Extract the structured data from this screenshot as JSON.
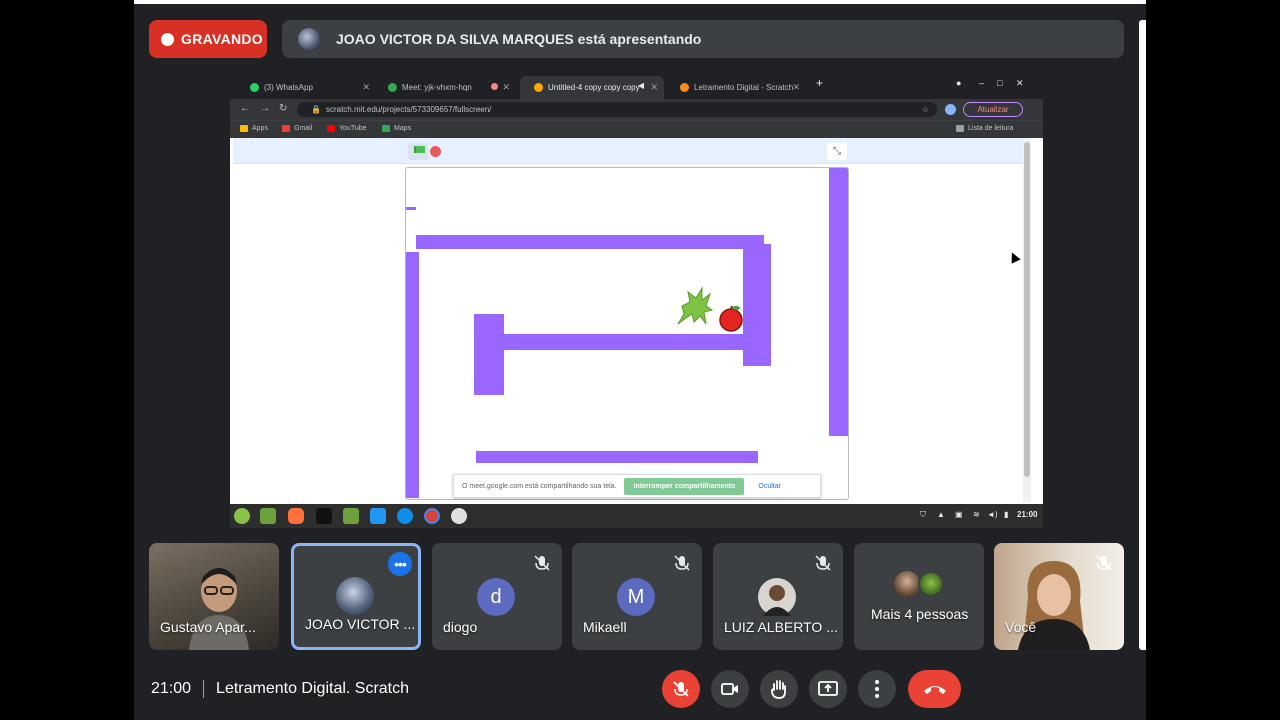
{
  "recording": {
    "label": "GRAVANDO"
  },
  "presentation": {
    "text": "JOAO VICTOR DA SILVA MARQUES está apresentando"
  },
  "browser": {
    "tabs": [
      {
        "title": "(3) WhatsApp",
        "color": "#25d366"
      },
      {
        "title": "Meet: yjk-vhxm-hqn",
        "color": "#34a853"
      },
      {
        "title": "Untitled-4 copy copy copy",
        "color": "#f9ab00"
      },
      {
        "title": "Letramento Digital - Scratch",
        "color": "#ff8c1a"
      }
    ],
    "new_tab": "+",
    "url": "scratch.mit.edu/projects/573309657/fullscreen/",
    "update_label": "Atualizar",
    "bookmarks": [
      {
        "label": "Apps",
        "color": "#fbbc04"
      },
      {
        "label": "Gmail",
        "color": "#ea4335"
      },
      {
        "label": "YouTube",
        "color": "#ff0000"
      },
      {
        "label": "Maps",
        "color": "#34a853"
      }
    ],
    "reading_list": "Lista de leitura"
  },
  "share_notice": {
    "text": "O meet.google.com está compartilhando sua tela.",
    "stop_label": "Interromper compartilhamento",
    "hide_label": "Ocultar"
  },
  "os_taskbar": {
    "time": "21:00"
  },
  "participants": [
    {
      "name": "Gustavo Apar...",
      "type": "video"
    },
    {
      "name": "JOAO VICTOR ...",
      "type": "avatar-image",
      "presenting": true
    },
    {
      "name": "diogo",
      "initial": "d",
      "avatar_color": "#5c6bc0",
      "muted": true
    },
    {
      "name": "Mikaell",
      "initial": "M",
      "avatar_color": "#5c6bc0",
      "muted": true
    },
    {
      "name": "LUIZ ALBERTO ...",
      "type": "avatar-image",
      "muted": true
    },
    {
      "name": "Mais 4 pessoas",
      "type": "group"
    },
    {
      "name": "Você",
      "type": "video",
      "muted": true
    }
  ],
  "meeting": {
    "time": "21:00",
    "title": "Letramento Digital. Scratch"
  },
  "controls": [
    "mic-off",
    "camera",
    "raise-hand",
    "present",
    "more",
    "leave"
  ]
}
